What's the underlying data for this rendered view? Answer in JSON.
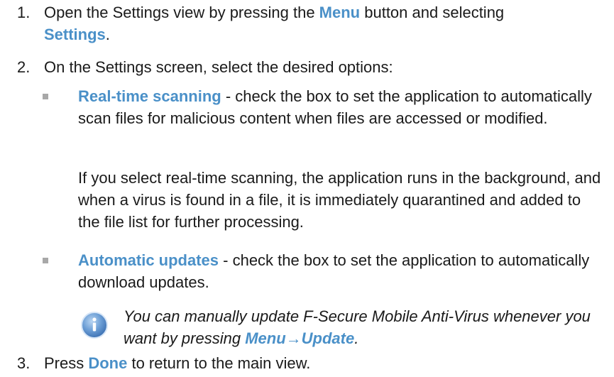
{
  "steps": [
    {
      "number": "1.",
      "before": "Open the Settings view by pressing the ",
      "hl1": "Menu",
      "middle": " button and selecting ",
      "hl2": "Settings",
      "after": "."
    },
    {
      "number": "2.",
      "text": "On the Settings screen, select the desired options:"
    },
    {
      "number": "3.",
      "before": "Press ",
      "hl1": "Done",
      "after": " to return to the main view."
    }
  ],
  "options": [
    {
      "label": "Real-time scanning",
      "desc": " - check the box to set the application to automatically scan files for malicious content when files are accessed or modified."
    },
    {
      "label": "Automatic updates",
      "desc": " - check the box to set the application to automatically download updates."
    }
  ],
  "realtime_note": "If you select real-time scanning, the application runs in the background, and when a virus is found in a file, it is immediately quarantined and added to the file list for further processing.",
  "info_note": {
    "text": "You can manually update F-Secure Mobile Anti-Virus whenever you want by pressing ",
    "menu": "Menu",
    "arrow": "→",
    "update": "Update",
    "end": ".",
    "icon": "info-icon"
  },
  "colors": {
    "highlight": "#4a90c8",
    "bullet": "#a8a8a8",
    "icon": "#6d9fd6"
  }
}
